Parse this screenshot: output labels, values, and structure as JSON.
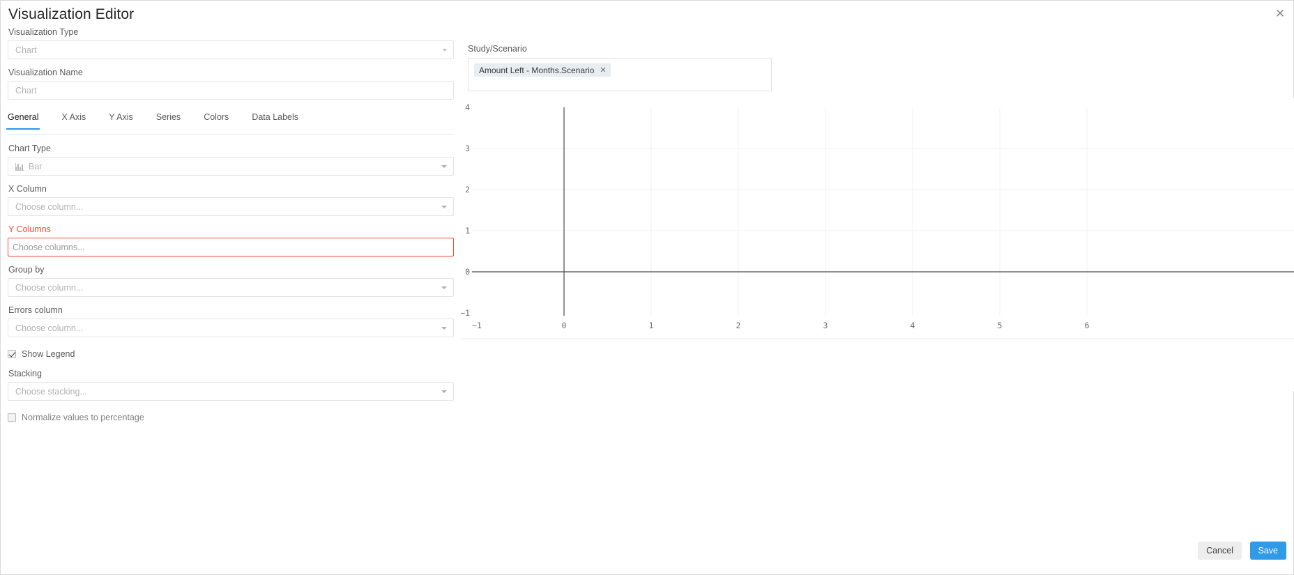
{
  "window": {
    "title": "Visualization Editor",
    "close_icon": "close-icon"
  },
  "left": {
    "viz_type": {
      "label": "Visualization Type",
      "value": "Chart",
      "placeholder": "Chart"
    },
    "viz_name": {
      "label": "Visualization Name",
      "value": "",
      "placeholder": "Chart"
    },
    "tabs": [
      {
        "label": "General",
        "active": true
      },
      {
        "label": "X Axis",
        "active": false
      },
      {
        "label": "Y Axis",
        "active": false
      },
      {
        "label": "Series",
        "active": false
      },
      {
        "label": "Colors",
        "active": false
      },
      {
        "label": "Data Labels",
        "active": false
      }
    ],
    "chart_type": {
      "label": "Chart Type",
      "value": "Bar",
      "icon": "bar-chart-icon"
    },
    "x_column": {
      "label": "X Column",
      "placeholder": "Choose column..."
    },
    "y_columns": {
      "label": "Y Columns",
      "placeholder": "Choose columns...",
      "error": true
    },
    "group_by": {
      "label": "Group by",
      "placeholder": "Choose column..."
    },
    "errors_column": {
      "label": "Errors column",
      "placeholder": "Choose column..."
    },
    "show_legend": {
      "label": "Show Legend",
      "checked": true
    },
    "stacking": {
      "label": "Stacking",
      "placeholder": "Choose stacking..."
    },
    "normalize": {
      "label": "Normalize values to percentage",
      "checked": false
    }
  },
  "right": {
    "scenario_label": "Study/Scenario",
    "tokens": [
      {
        "label": "Amount Left - Months.Scenario",
        "remove_icon": "close-icon"
      }
    ]
  },
  "footer": {
    "cancel_label": "Cancel",
    "save_label": "Save"
  },
  "colors": {
    "accent": "#2f9ae8",
    "error": "#f5492f",
    "tab_underline": "#2f94e8",
    "token_bg": "#e8edf1"
  },
  "chart_data": {
    "type": "scatter",
    "title": "",
    "xlabel": "",
    "ylabel": "",
    "series": [],
    "x": [],
    "values": [],
    "xticks": [
      -1,
      0,
      1,
      2,
      3,
      4,
      5,
      6
    ],
    "yticks": [
      -1,
      0,
      1,
      2,
      3,
      4
    ],
    "xlim": [
      -1,
      6
    ],
    "ylim": [
      -1,
      4
    ],
    "grid": true,
    "legend": "none",
    "empty": true
  }
}
